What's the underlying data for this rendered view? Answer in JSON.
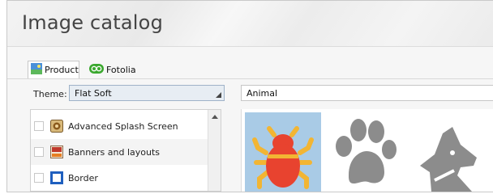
{
  "window": {
    "title": "Image catalog"
  },
  "tabs": [
    {
      "label": "Product",
      "icon": "product-icon",
      "active": true
    },
    {
      "label": "Fotolia",
      "icon": "fotolia-icon",
      "active": false
    }
  ],
  "theme": {
    "label": "Theme:",
    "value": "Flat Soft"
  },
  "search": {
    "value": "Animal"
  },
  "categories": [
    {
      "label": "Advanced Splash Screen",
      "icon": "splash-screen-icon",
      "checked": false
    },
    {
      "label": "Banners and layouts",
      "icon": "banner-icon",
      "checked": false
    },
    {
      "label": "Border",
      "icon": "border-icon",
      "checked": false
    }
  ],
  "gallery": [
    {
      "icon": "bug-icon",
      "selected": true
    },
    {
      "icon": "paw-icon",
      "selected": false
    },
    {
      "icon": "dog-icon",
      "selected": false
    }
  ],
  "colors": {
    "accent": "#a9cbe6",
    "bug_body": "#e8432f",
    "bug_legs": "#f2b533",
    "gray_icon": "#8c8c8c"
  }
}
